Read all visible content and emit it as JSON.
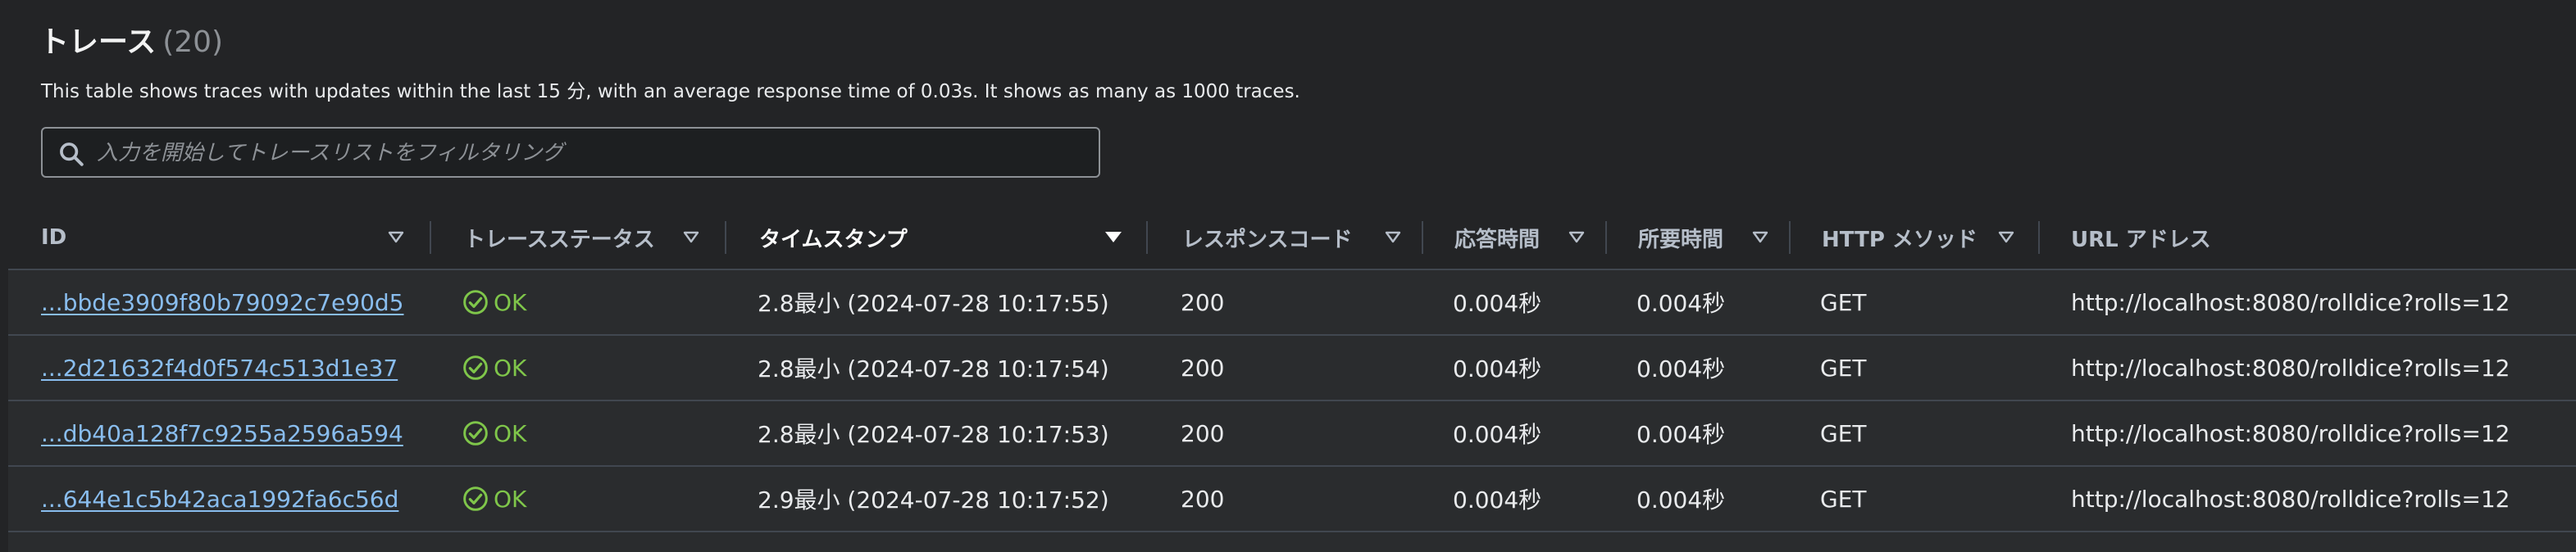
{
  "header": {
    "title": "トレース",
    "count": "(20)",
    "description": "This table shows traces with updates within the last 15 分, with an average response time of 0.03s. It shows as many as 1000 traces."
  },
  "search": {
    "placeholder": "入力を開始してトレースリストをフィルタリング",
    "value": ""
  },
  "columns": [
    {
      "label": "ID",
      "sortable": true
    },
    {
      "label": "トレースステータス",
      "sortable": true
    },
    {
      "label": "タイムスタンプ",
      "sortable": true,
      "active": true
    },
    {
      "label": "レスポンスコード",
      "sortable": true
    },
    {
      "label": "応答時間",
      "sortable": true
    },
    {
      "label": "所要時間",
      "sortable": true
    },
    {
      "label": "HTTP メソッド",
      "sortable": true
    },
    {
      "label": "URL アドレス",
      "sortable": false
    }
  ],
  "rows": [
    {
      "id": "...bbde3909f80b79092c7e90d5",
      "status": "OK",
      "timestamp": "2.8最小 (2024-07-28 10:17:55)",
      "response_code": "200",
      "response_time": "0.004秒",
      "duration": "0.004秒",
      "method": "GET",
      "url": "http://localhost:8080/rolldice?rolls=12"
    },
    {
      "id": "...2d21632f4d0f574c513d1e37",
      "status": "OK",
      "timestamp": "2.8最小 (2024-07-28 10:17:54)",
      "response_code": "200",
      "response_time": "0.004秒",
      "duration": "0.004秒",
      "method": "GET",
      "url": "http://localhost:8080/rolldice?rolls=12"
    },
    {
      "id": "...db40a128f7c9255a2596a594",
      "status": "OK",
      "timestamp": "2.8最小 (2024-07-28 10:17:53)",
      "response_code": "200",
      "response_time": "0.004秒",
      "duration": "0.004秒",
      "method": "GET",
      "url": "http://localhost:8080/rolldice?rolls=12"
    },
    {
      "id": "...644e1c5b42aca1992fa6c56d",
      "status": "OK",
      "timestamp": "2.9最小 (2024-07-28 10:17:52)",
      "response_code": "200",
      "response_time": "0.004秒",
      "duration": "0.004秒",
      "method": "GET",
      "url": "http://localhost:8080/rolldice?rolls=12"
    }
  ],
  "colors": {
    "background": "#232426",
    "row_background": "#2a2c2e",
    "link": "#89bdee",
    "status_ok": "#7fc64a",
    "header_text": "#b6bec9",
    "divider": "#414750"
  },
  "icons": {
    "search": "search-icon",
    "sort": "caret-down-icon",
    "status_ok": "check-circle-icon"
  }
}
